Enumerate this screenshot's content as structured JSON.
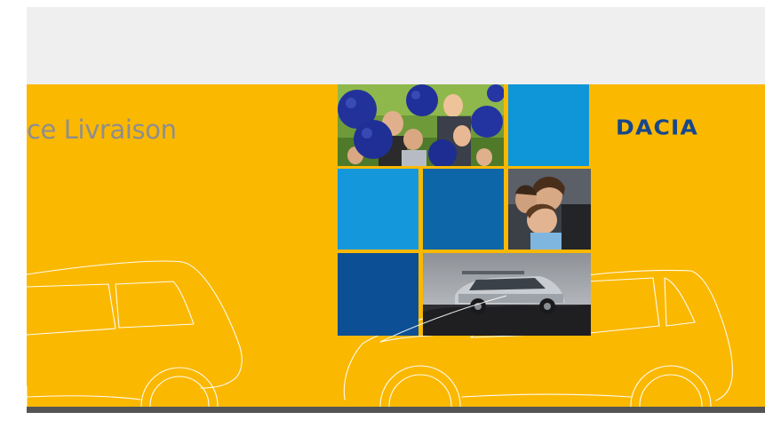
{
  "slide": {
    "title": "ce Livraison",
    "brand": "DACIA"
  },
  "colors": {
    "background_yellow": "#fbb800",
    "title_gray": "#8e8e8e",
    "brand_blue": "#17478c",
    "tile_blue_light": "#1598db",
    "tile_blue_mid": "#0d66a7",
    "tile_blue_dark": "#0c4f94",
    "top_band": "#efefef",
    "bottom_bar": "#545454"
  },
  "mosaic": {
    "tiles": [
      {
        "kind": "photo",
        "subject": "friends-with-blue-balloons"
      },
      {
        "kind": "color",
        "color": "#0f96d8"
      },
      {
        "kind": "color",
        "color": "#1598db"
      },
      {
        "kind": "color",
        "color": "#0d66a7"
      },
      {
        "kind": "photo",
        "subject": "smiling-friends"
      },
      {
        "kind": "color",
        "color": "#0c4f94"
      },
      {
        "kind": "photo",
        "subject": "silver-dacia-duster-suv"
      }
    ]
  },
  "icons": [
    "dacia-logo",
    "car-outline"
  ]
}
